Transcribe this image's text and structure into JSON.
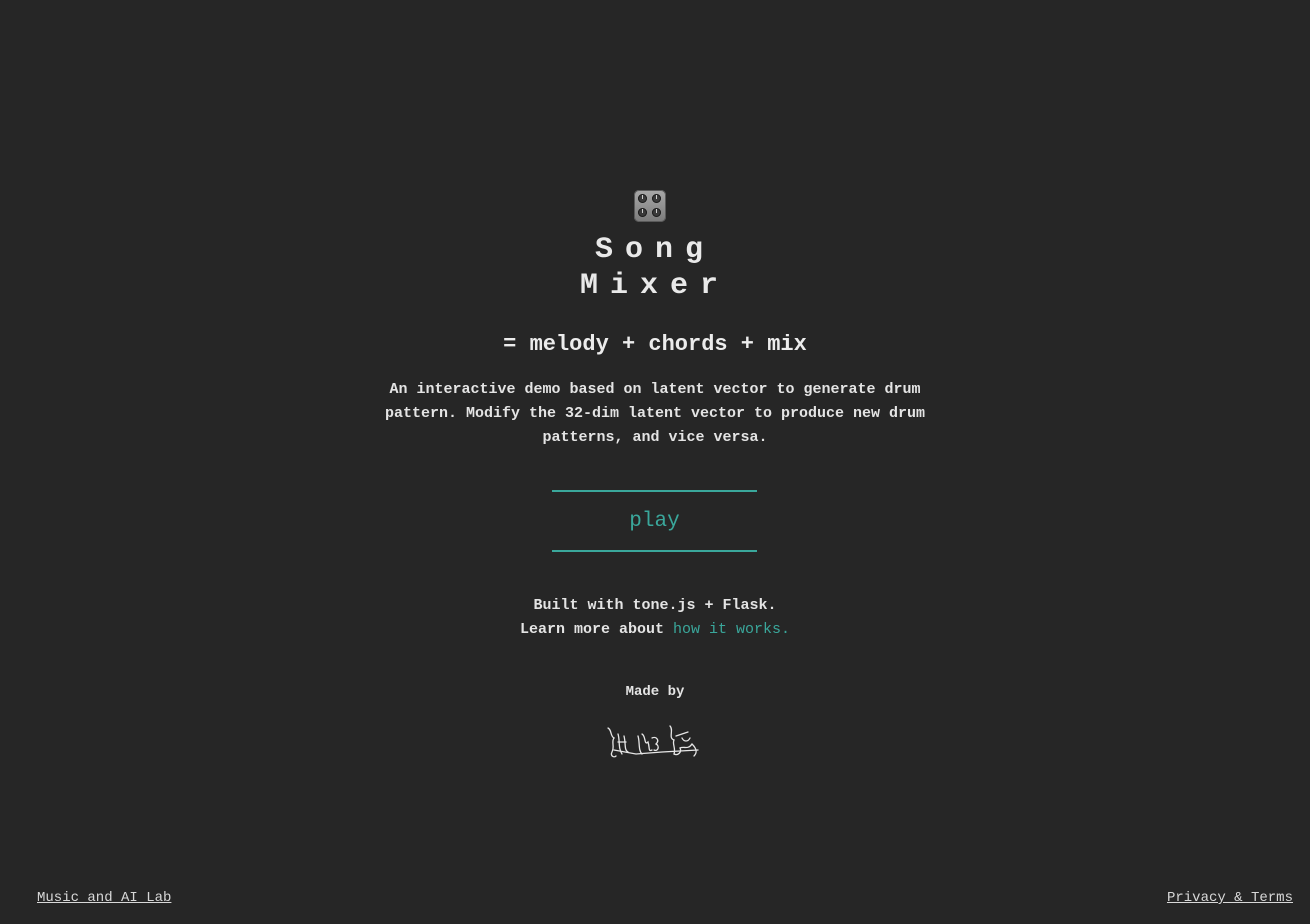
{
  "app": {
    "logo_icon": "mixer-knobs-icon",
    "title_line_1": "Song",
    "title_line_2": "Mixer",
    "subtitle": "= melody + chords + mix",
    "description": "An interactive demo based on latent vector to generate drum pattern. Modify the 32-dim latent vector to produce new drum patterns, and vice versa."
  },
  "controls": {
    "play_label": "play"
  },
  "credits": {
    "built_with": "Built with tone.js + Flask.",
    "learn_more_prefix": "Learn more about",
    "learn_more_link": "how it works.",
    "made_by": "Made by",
    "signature_icon": "handwritten-signature"
  },
  "footer": {
    "left_link": "Music and AI Lab",
    "right_link": "Privacy & Terms"
  },
  "colors": {
    "background": "#262626",
    "accent": "#3aa79b",
    "text": "#e6e6e6"
  }
}
